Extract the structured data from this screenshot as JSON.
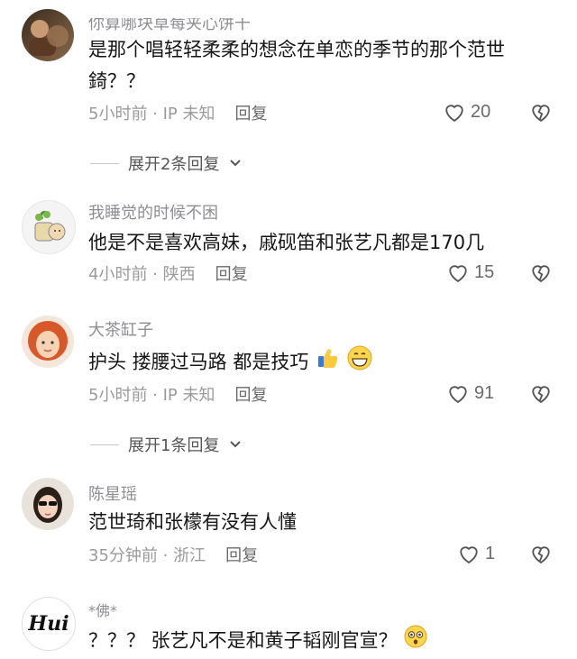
{
  "comments": [
    {
      "username": "你算哪块草莓夹心饼干",
      "text": "是那个唱轻轻柔柔的想念在单恋的季节的那个范世錡？？",
      "time_location": "5小时前 · IP 未知",
      "reply_label": "回复",
      "likes": "20",
      "expand_label": "展开2条回复"
    },
    {
      "username": "我睡觉的时候不困",
      "text": "他是不是喜欢高妹，戚砚笛和张艺凡都是170几",
      "time_location": "4小时前 · 陕西",
      "reply_label": "回复",
      "likes": "15"
    },
    {
      "username": "大茶缸子",
      "text": "护头 搂腰过马路 都是技巧",
      "time_location": "5小时前 · IP 未知",
      "reply_label": "回复",
      "likes": "91",
      "expand_label": "展开1条回复"
    },
    {
      "username": "陈星瑶",
      "text": "范世琦和张檬有没有人懂",
      "time_location": "35分钟前 · 浙江",
      "reply_label": "回复",
      "likes": "1"
    },
    {
      "username": "*佛*",
      "text": "？？？ 张艺凡不是和黄子韬刚官宣？",
      "avatar_text": "Hui"
    }
  ],
  "icons": [
    "heart-icon",
    "broken-heart-icon",
    "chevron-down-icon",
    "thumbs-up-emoji",
    "grin-emoji",
    "flushed-emoji"
  ]
}
